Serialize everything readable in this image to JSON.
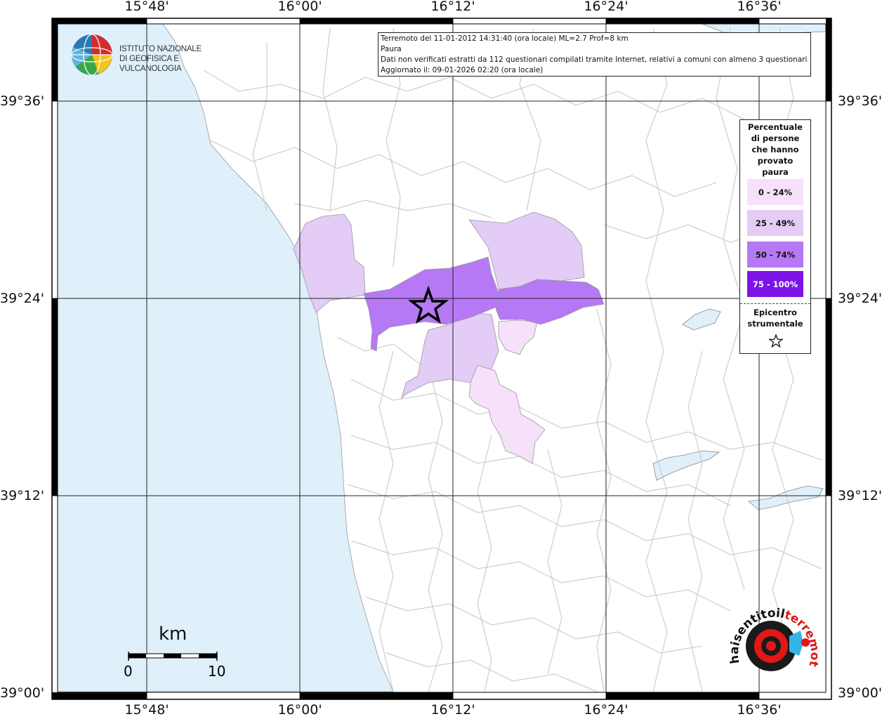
{
  "info": {
    "line1": "Terremoto del 11-01-2012 14:31:40 (ora locale) ML=2.7 Prof=8 km",
    "line2": "Paura",
    "line3": "Dati non verificati estratti da 112 questionari compilati tramite Internet, relativi a comuni con almeno 3 questionari.",
    "line4": "Aggiornato il: 09-01-2026 02:20 (ora locale)"
  },
  "institute": {
    "name_line1": "ISTITUTO NAZIONALE",
    "name_line2": "DI GEOFISICA E VULCANOLOGIA"
  },
  "longitude_labels": [
    "15°48'",
    "16°00'",
    "16°12'",
    "16°24'",
    "16°36'"
  ],
  "latitude_labels": [
    "39°36'",
    "39°24'",
    "39°12'",
    "39°00'"
  ],
  "legend": {
    "title_lines": [
      "Percentuale",
      "di persone",
      "che hanno",
      "provato",
      "paura"
    ],
    "classes": [
      {
        "label": "0 - 24%",
        "color": "#f6e0fa"
      },
      {
        "label": "25 - 49%",
        "color": "#e3ccf6"
      },
      {
        "label": "50 - 74%",
        "color": "#b678f5"
      },
      {
        "label": "75 - 100%",
        "color": "#7c14e8"
      }
    ],
    "epicenter_lines": [
      "Epicentro",
      "strumentale"
    ],
    "epicenter_icon": "star-icon"
  },
  "scale_bar": {
    "unit": "km",
    "min_label": "0",
    "max_label": "10"
  },
  "hsi_logo": {
    "text": "www.haisentitoilterremoto.it",
    "text_before_red": "haisentitoil",
    "text_red": "terremoto.it"
  },
  "colors": {
    "sea": "#dff0fb",
    "land": "#ffffff",
    "boundaries": "#c4c4c4",
    "grid": "#222222",
    "epicenter_star": "#000000"
  }
}
